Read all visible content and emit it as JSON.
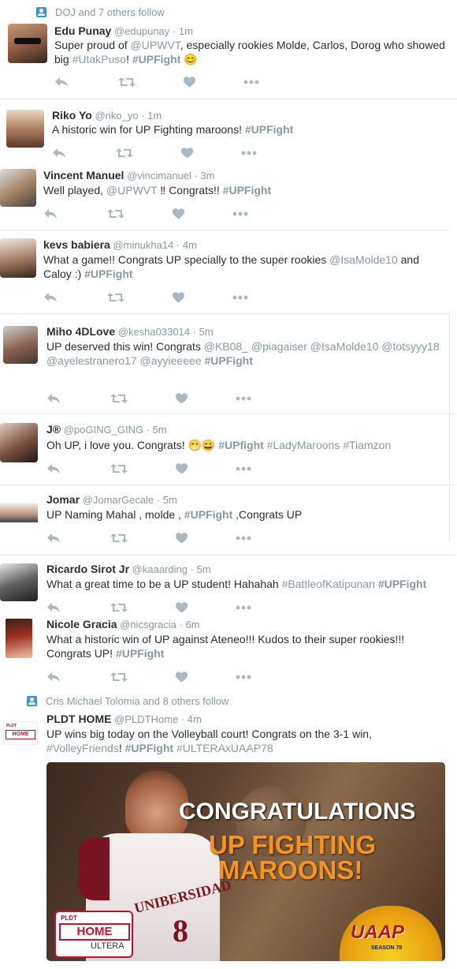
{
  "context_1": "DOJ and 7 others follow",
  "context_2": "Cris Michael Tolomia and 8 others follow",
  "tweets": [
    {
      "name": "Edu Punay",
      "handle": "@edupunay",
      "dot": "·",
      "time": "1m",
      "text": [
        {
          "t": "Super proud of ",
          "c": ""
        },
        {
          "t": "@UPWVT",
          "c": "m"
        },
        {
          "t": ", especially rookies Molde, Carlos, Dorog who showed big ",
          "c": ""
        },
        {
          "t": "#UtakPuso",
          "c": "h"
        },
        {
          "t": "! ",
          "c": ""
        },
        {
          "t": "#UPFight",
          "c": "hb"
        },
        {
          "t": " 😊",
          "c": ""
        }
      ]
    },
    {
      "name": "Riko Yo",
      "handle": "@riko_yo",
      "dot": "·",
      "time": "1m",
      "text": [
        {
          "t": "A historic win for UP Fighting maroons! ",
          "c": ""
        },
        {
          "t": "#UPFight",
          "c": "hb"
        }
      ]
    },
    {
      "name": "Vincent Manuel",
      "handle": "@vincimanuel",
      "dot": "·",
      "time": "3m",
      "text": [
        {
          "t": "Well played, ",
          "c": ""
        },
        {
          "t": "@UPWVT",
          "c": "m"
        },
        {
          "t": " ‼ Congrats!! ",
          "c": ""
        },
        {
          "t": "#UPFight",
          "c": "hb"
        }
      ]
    },
    {
      "name": "kevs babiera",
      "handle": "@minukha14",
      "dot": "·",
      "time": "4m",
      "text": [
        {
          "t": "What a game!! Congrats UP specially to the super rookies ",
          "c": ""
        },
        {
          "t": "@IsaMolde10",
          "c": "m"
        },
        {
          "t": " and Caloy :) ",
          "c": ""
        },
        {
          "t": "#UPFight",
          "c": "hb"
        }
      ]
    },
    {
      "name": "Miho 4DLove",
      "handle": "@kesha033014",
      "dot": "·",
      "time": "5m",
      "text": [
        {
          "t": "UP deserved this win! Congrats ",
          "c": ""
        },
        {
          "t": "@KB08_",
          "c": "m"
        },
        {
          "t": " ",
          "c": ""
        },
        {
          "t": "@piagaiser",
          "c": "m"
        },
        {
          "t": " ",
          "c": ""
        },
        {
          "t": "@IsaMolde10",
          "c": "m"
        },
        {
          "t": " ",
          "c": ""
        },
        {
          "t": "@totsyyy18",
          "c": "m"
        },
        {
          "t": " ",
          "c": ""
        },
        {
          "t": "@ayelestranero17",
          "c": "m"
        },
        {
          "t": " ",
          "c": ""
        },
        {
          "t": "@ayyieeeee",
          "c": "m"
        },
        {
          "t": " ",
          "c": ""
        },
        {
          "t": "#UPFight",
          "c": "hb"
        }
      ]
    },
    {
      "name": "J®",
      "handle": "@poGING_GING",
      "dot": "·",
      "time": "5m",
      "text": [
        {
          "t": "Oh UP, i love you. Congrats! 😁😄 ",
          "c": ""
        },
        {
          "t": "#UPfight",
          "c": "hb"
        },
        {
          "t": " ",
          "c": ""
        },
        {
          "t": "#LadyMaroons",
          "c": "h"
        },
        {
          "t": " ",
          "c": ""
        },
        {
          "t": "#Tiamzon",
          "c": "h"
        }
      ]
    },
    {
      "name": "Jomar",
      "handle": "@JomarGecale",
      "dot": "·",
      "time": "5m",
      "text": [
        {
          "t": "UP Naming Mahal , molde , ",
          "c": ""
        },
        {
          "t": "#UPFight",
          "c": "hb"
        },
        {
          "t": " ,Congrats UP",
          "c": ""
        }
      ]
    },
    {
      "name": "Ricardo Sirot Jr",
      "handle": "@kaaarding",
      "dot": "·",
      "time": "5m",
      "text": [
        {
          "t": "What a great time to be a UP student! Hahahah ",
          "c": ""
        },
        {
          "t": "#BattleofKatipunan",
          "c": "h"
        },
        {
          "t": " ",
          "c": ""
        },
        {
          "t": "#UPFight",
          "c": "hb"
        }
      ]
    },
    {
      "name": "Nicole Gracia",
      "handle": "@nicsgracia",
      "dot": "·",
      "time": "6m",
      "text": [
        {
          "t": "What a historic win of UP against Ateneo!!! Kudos to their super rookies!!! Congrats UP! ",
          "c": ""
        },
        {
          "t": "#UPFight",
          "c": "hb"
        }
      ]
    },
    {
      "name": "PLDT HOME",
      "handle": "@PLDTHome",
      "dot": "·",
      "time": "4m",
      "text": [
        {
          "t": "UP wins big today on the Volleyball court! Congrats on the 3-1 win, ",
          "c": ""
        },
        {
          "t": "#VolleyFriends",
          "c": "h"
        },
        {
          "t": "! ",
          "c": ""
        },
        {
          "t": "#UPFight",
          "c": "hb"
        },
        {
          "t": " ",
          "c": ""
        },
        {
          "t": "#ULTERAxUAAP78",
          "c": "h"
        }
      ]
    }
  ],
  "promo": {
    "line1": "CONGRATULATIONS",
    "line2": "UP FIGHTING",
    "line3": "MAROONS!",
    "jersey": "UNIBERSIDAD",
    "jersey_num": "8",
    "logo_small": "PLDT",
    "logo_home": "HOME",
    "logo_ultera": "ULTERA",
    "uaap": "UAAP",
    "uaap_season": "SEASON 78",
    "avatar_logo_small": "PLDT",
    "avatar_logo": "HOME"
  },
  "colors": {
    "muted": "#8899a6",
    "text": "#292f33",
    "border": "#e1e8ed",
    "accent": "#3b94d9",
    "orange": "#f7941d"
  }
}
